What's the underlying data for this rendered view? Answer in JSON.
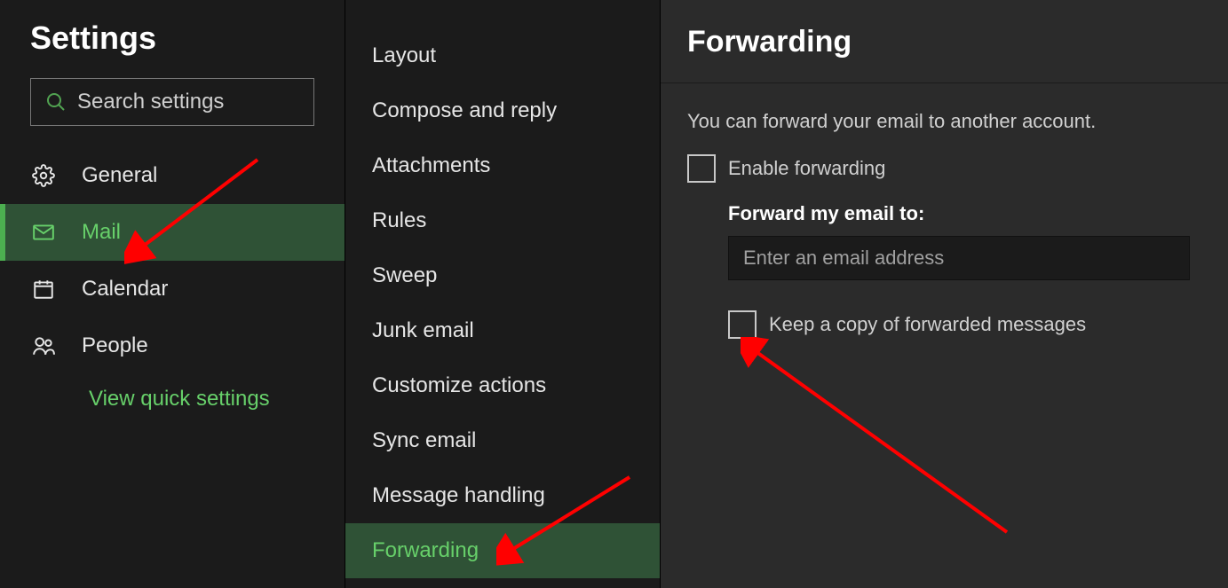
{
  "sidebar": {
    "title": "Settings",
    "search_placeholder": "Search settings",
    "items": [
      {
        "label": "General"
      },
      {
        "label": "Mail"
      },
      {
        "label": "Calendar"
      },
      {
        "label": "People"
      }
    ],
    "quick_settings_label": "View quick settings"
  },
  "categories": [
    {
      "label": "Layout"
    },
    {
      "label": "Compose and reply"
    },
    {
      "label": "Attachments"
    },
    {
      "label": "Rules"
    },
    {
      "label": "Sweep"
    },
    {
      "label": "Junk email"
    },
    {
      "label": "Customize actions"
    },
    {
      "label": "Sync email"
    },
    {
      "label": "Message handling"
    },
    {
      "label": "Forwarding"
    }
  ],
  "detail": {
    "heading": "Forwarding",
    "description": "You can forward your email to another account.",
    "enable_label": "Enable forwarding",
    "forward_to_label": "Forward my email to:",
    "email_placeholder": "Enter an email address",
    "keep_copy_label": "Keep a copy of forwarded messages"
  }
}
